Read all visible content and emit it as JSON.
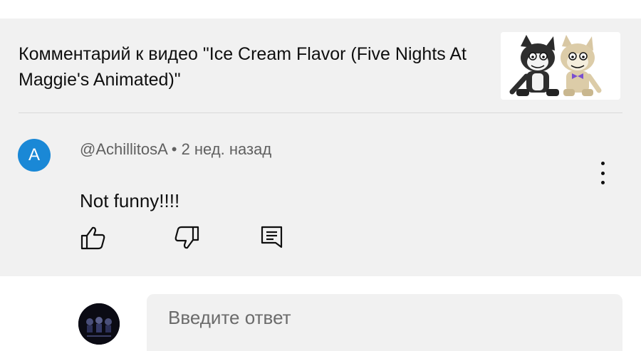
{
  "video": {
    "title": "Комментарий к видео \"Ice Cream Flavor (Five Nights At Maggie's Animated)\""
  },
  "comment": {
    "avatar_letter": "A",
    "author": "@AchillitosA",
    "separator": "•",
    "time": "2 нед. назад",
    "text": "Not funny!!!!"
  },
  "actions": [
    {
      "icon": "thumbs-up-icon"
    },
    {
      "icon": "thumbs-down-icon"
    },
    {
      "icon": "reply-comment-icon"
    }
  ],
  "reply": {
    "placeholder": "Введите ответ"
  },
  "colors": {
    "panel_bg": "#f1f1f1",
    "avatar_bg": "#1a88d6",
    "meta_text": "#606060"
  }
}
